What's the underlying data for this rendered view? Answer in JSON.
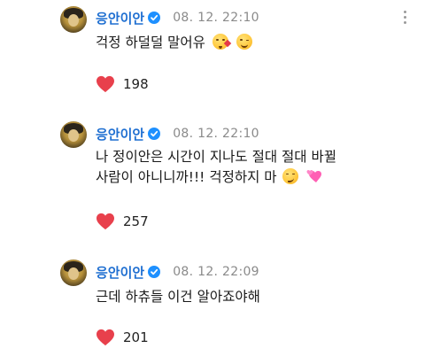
{
  "comments": [
    {
      "author": "응안이안",
      "verified": true,
      "timestamp": "08. 12. 22:10",
      "lines": [
        "걱정 하덜덜 말어유"
      ],
      "emojis": [
        "kissing-heart-emoji",
        "wink-emoji"
      ],
      "likes": "198"
    },
    {
      "author": "응안이안",
      "verified": true,
      "timestamp": "08. 12. 22:10",
      "lines": [
        "나 정이안은 시간이 지나도 절대 절대 바뀔",
        "사람이 아니니까!!! 걱정하지 마"
      ],
      "emojis": [
        "smirk-emoji",
        "two-hearts-emoji"
      ],
      "likes": "257"
    },
    {
      "author": "응안이안",
      "verified": true,
      "timestamp": "08. 12. 22:09",
      "lines": [
        "근데 하츄들 이건 알아죠야해"
      ],
      "emojis": [],
      "likes": "201"
    }
  ],
  "colors": {
    "author": "#1f6fd1",
    "verified": "#1e90ff",
    "timestamp": "#8a8a8a",
    "like_heart": "#e8404c"
  },
  "icons": {
    "like": "heart-icon",
    "menu": "more-vertical-icon",
    "badge": "verified-badge-icon"
  }
}
